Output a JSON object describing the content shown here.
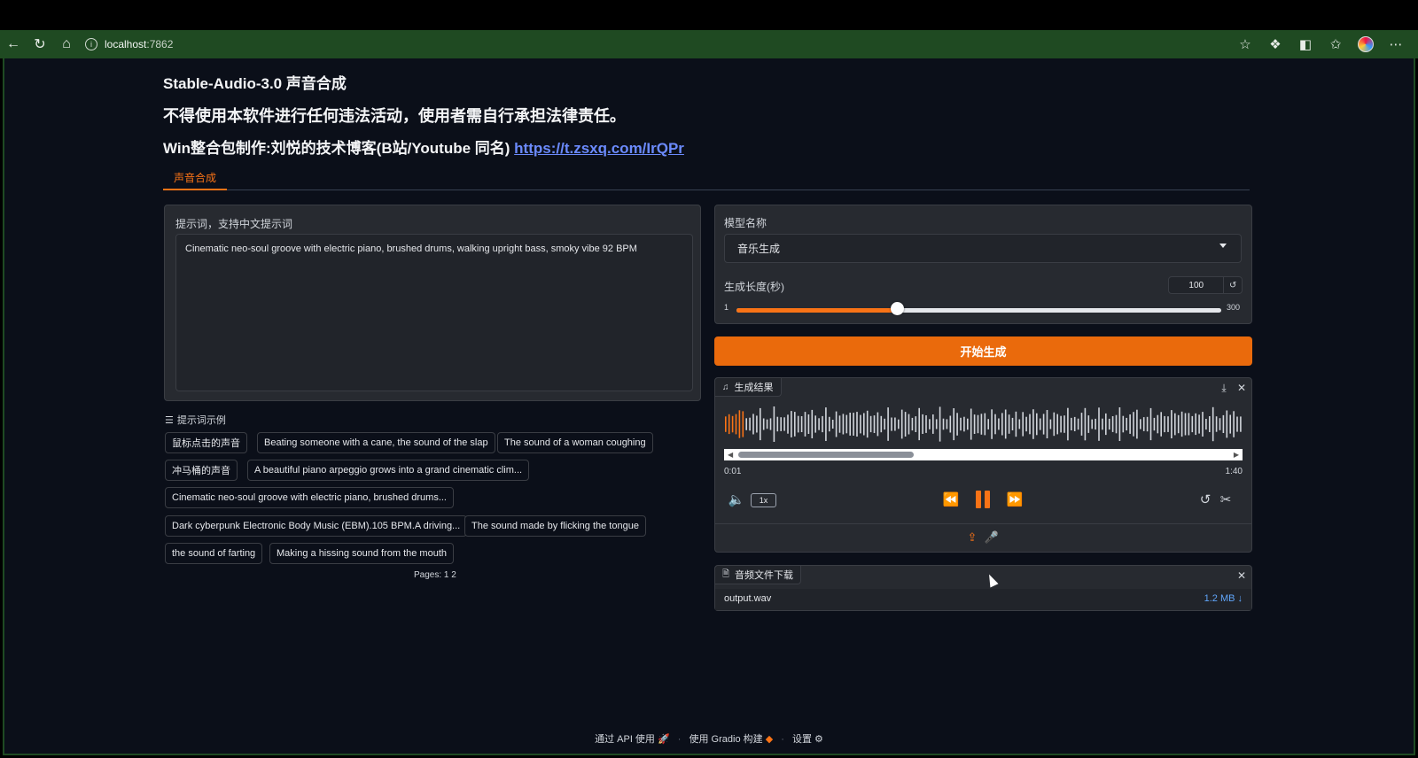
{
  "browser": {
    "url_host": "localhost",
    "url_port": ":7862"
  },
  "header": {
    "title": "Stable-Audio-3.0 声音合成",
    "warning": "不得使用本软件进行任何违法活动，使用者需自行承担法律责任。",
    "credit_prefix": "Win整合包制作:刘悦的技术博客(B站/Youtube 同名) ",
    "credit_link": "https://t.zsxq.com/IrQPr"
  },
  "tabs": [
    {
      "label": "声音合成",
      "active": true
    }
  ],
  "prompt": {
    "label": "提示词，支持中文提示词",
    "value": "Cinematic neo-soul groove with electric piano, brushed drums, walking upright bass, smoky vibe 92 BPM"
  },
  "examples": {
    "header": "提示词示例",
    "items": [
      "鼠标点击的声音",
      "Beating someone with a cane, the sound of the slap",
      "The sound of a woman coughing",
      "冲马桶的声音",
      "A beautiful piano arpeggio grows into a grand cinematic clim...",
      "Cinematic neo-soul groove with electric piano, brushed drums...",
      "Dark cyberpunk Electronic Body Music (EBM).105 BPM.A driving...",
      "The sound made by flicking the tongue",
      "the sound of farting",
      "Making a hissing sound from the mouth"
    ],
    "pages_label": "Pages:",
    "pages": [
      "1",
      "2"
    ]
  },
  "settings": {
    "model_label": "模型名称",
    "model_value": "音乐生成",
    "length_label": "生成长度(秒)",
    "length_value": "100",
    "length_min": "1",
    "length_max": "300",
    "length_fraction": 0.331
  },
  "generate_button": "开始生成",
  "audio": {
    "label": "生成结果",
    "current_time": "0:01",
    "duration": "1:40",
    "speed": "1x",
    "progress_fraction": 0.01
  },
  "file": {
    "label": "音频文件下载",
    "name": "output.wav",
    "size": "1.2 MB ↓"
  },
  "footer": {
    "api": "通过 API 使用",
    "gradio": "使用 Gradio 构建",
    "settings": "设置"
  },
  "colors": {
    "accent": "#f97316",
    "button": "#ea6a0c",
    "link": "#6b8afd",
    "browser_frame": "#1f4a22"
  }
}
